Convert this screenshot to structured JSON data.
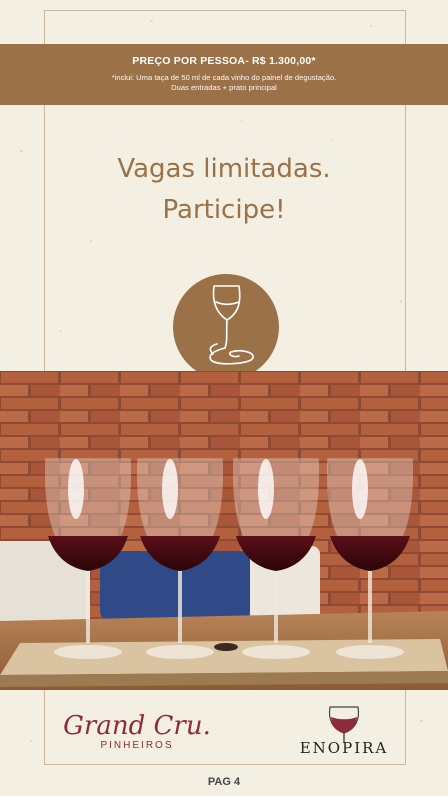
{
  "banner": {
    "price": "PREÇO POR PESSOA- R$ 1.300,00*",
    "note_line1": "*inclui: Uma taça de 50 ml de cada vinho do painel de degustação.",
    "note_line2": "Duas entradas + prato principal"
  },
  "headline": {
    "line1": "Vagas limitadas.",
    "line2": "Participe!"
  },
  "logos": {
    "grand_cru": "Grand Cru.",
    "grand_cru_sub": "PINHEIROS",
    "enopira": "ENOPIRA"
  },
  "footer": {
    "page": "PAG 4"
  },
  "colors": {
    "accent": "#9b7248",
    "background": "#f3efe3",
    "wine": "#8f2a3a"
  }
}
